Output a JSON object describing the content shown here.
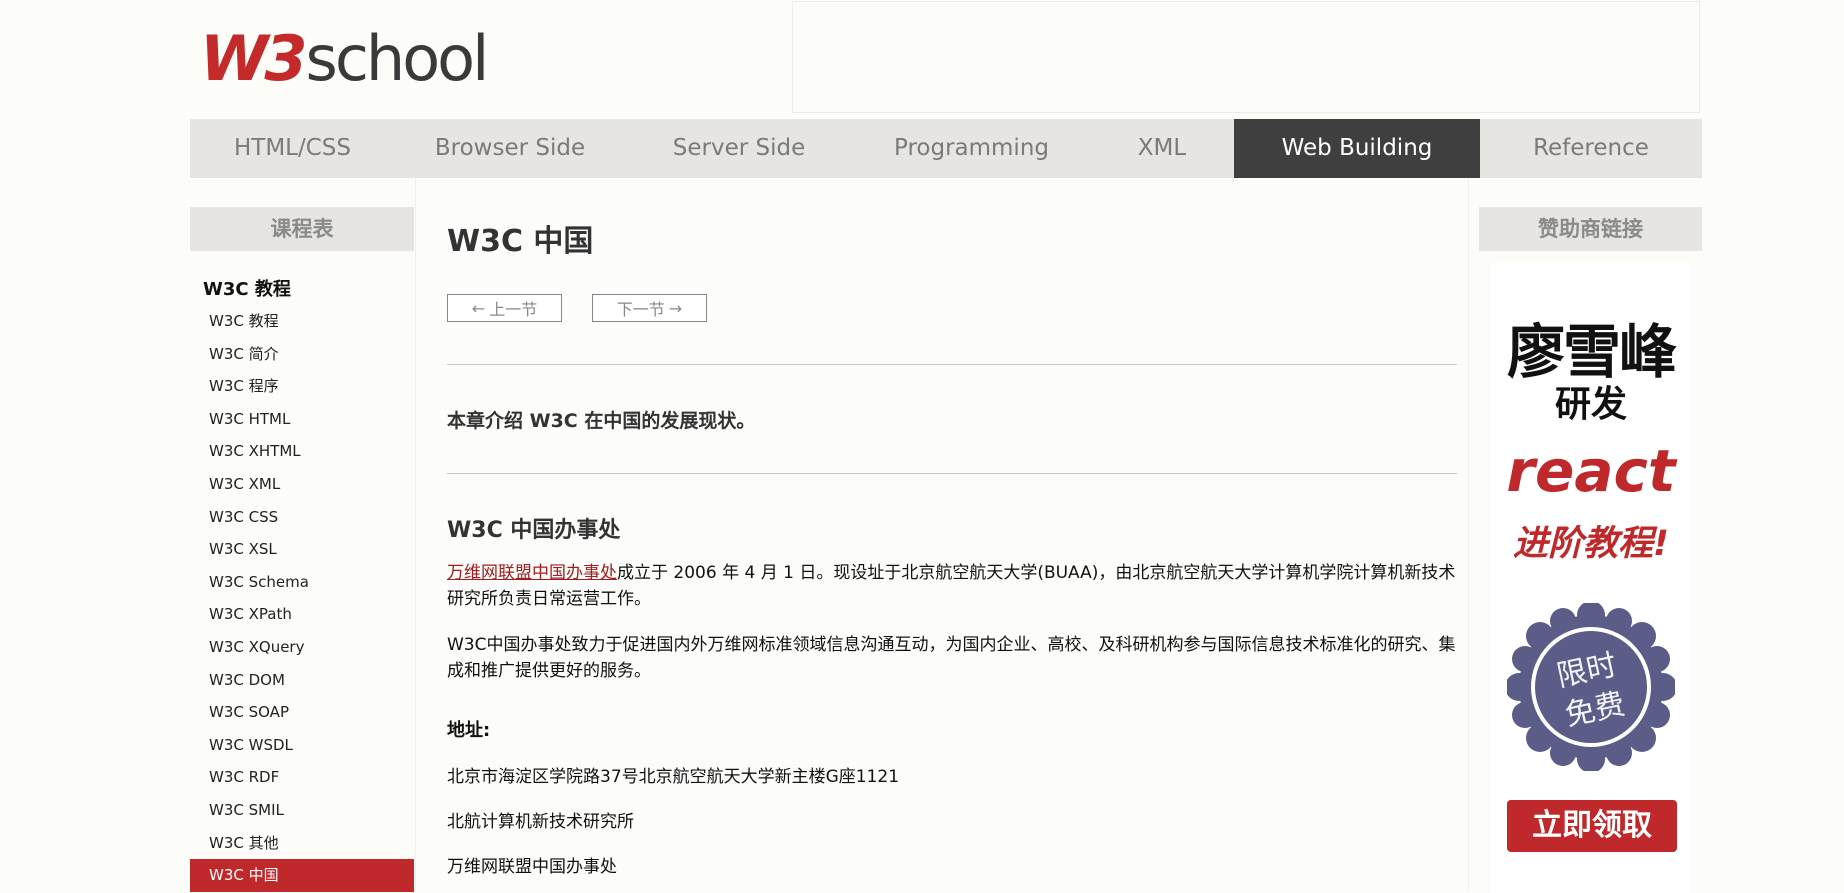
{
  "header": {
    "logo_w3": "W3",
    "logo_school": "school"
  },
  "nav": {
    "items": [
      {
        "label": "HTML/CSS"
      },
      {
        "label": "Browser Side"
      },
      {
        "label": "Server Side"
      },
      {
        "label": "Programming"
      },
      {
        "label": "XML"
      },
      {
        "label": "Web Building"
      },
      {
        "label": "Reference"
      }
    ],
    "active": "Web Building"
  },
  "sidebar": {
    "heading": "课程表",
    "title": "W3C 教程",
    "items": [
      {
        "label": "W3C 教程"
      },
      {
        "label": "W3C 简介"
      },
      {
        "label": "W3C 程序"
      },
      {
        "label": "W3C HTML"
      },
      {
        "label": "W3C XHTML"
      },
      {
        "label": "W3C XML"
      },
      {
        "label": "W3C CSS"
      },
      {
        "label": "W3C XSL"
      },
      {
        "label": "W3C Schema"
      },
      {
        "label": "W3C XPath"
      },
      {
        "label": "W3C XQuery"
      },
      {
        "label": "W3C DOM"
      },
      {
        "label": "W3C SOAP"
      },
      {
        "label": "W3C WSDL"
      },
      {
        "label": "W3C RDF"
      },
      {
        "label": "W3C SMIL"
      },
      {
        "label": "W3C 其他"
      },
      {
        "label": "W3C 中国"
      }
    ],
    "active": "W3C 中国"
  },
  "main": {
    "title": "W3C 中国",
    "prev_label": "上一节",
    "next_label": "下一节",
    "intro": "本章介绍 W3C 在中国的发展现状。",
    "section_title": "W3C 中国办事处",
    "p1_link": "万维网联盟中国办事处",
    "p1_text": "成立于 2006 年 4 月 1 日。现设址于北京航空航天大学(BUAA)，由北京航空航天大学计算机学院计算机新技术研究所负责日常运营工作。",
    "p2_text": "W3C中国办事处致力于促进国内外万维网标准领域信息沟通互动，为国内企业、高校、及科研机构参与国际信息技术标准化的研究、集成和推广提供更好的服务。",
    "address_label": "地址:",
    "address_lines": [
      "北京市海淀区学院路37号北京航空航天大学新主楼G座1121",
      "北航计算机新技术研究所",
      "万维网联盟中国办事处"
    ]
  },
  "right": {
    "heading": "赞助商链接",
    "ad_line1": "廖雪峰",
    "ad_line2": "研发",
    "ad_line3": "react",
    "ad_line4": "进阶教程!",
    "badge_line1": "限时",
    "badge_line2": "免费",
    "button": "立即领取"
  },
  "colors": {
    "brand_red": "#c0292b",
    "nav_bg": "#e6e5e1",
    "nav_active": "#3f3f3f",
    "badge": "#5b5d88"
  }
}
